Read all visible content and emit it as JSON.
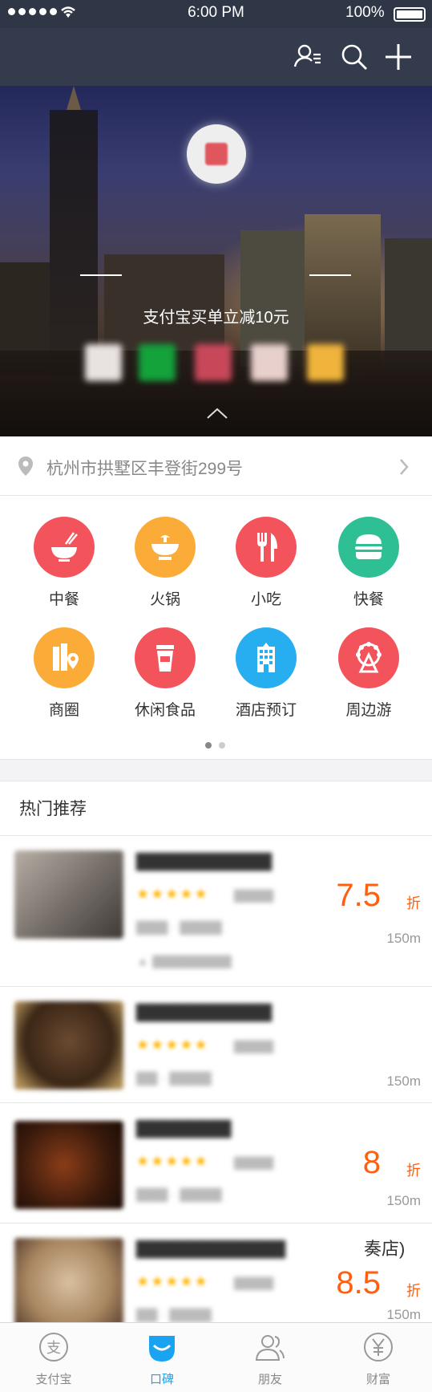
{
  "status_bar": {
    "time": "6:00 PM",
    "battery": "100%"
  },
  "nav": {
    "icons": [
      "contacts-icon",
      "search-icon",
      "add-icon"
    ]
  },
  "banner": {
    "subtitle": "支付宝买单立减10元",
    "colors": {
      "thumb1": "#e8e2e0",
      "thumb2": "#14a23b",
      "thumb3": "#c8485a",
      "thumb4": "#e8d0cc",
      "thumb5": "#f0b43c"
    }
  },
  "address": {
    "text": "杭州市拱墅区丰登街299号"
  },
  "categories": [
    {
      "label": "中餐",
      "icon": "bowl-chopsticks-icon",
      "color": "#f3545c"
    },
    {
      "label": "火锅",
      "icon": "hotpot-icon",
      "color": "#fbab38"
    },
    {
      "label": "小吃",
      "icon": "fork-knife-icon",
      "color": "#f3545c"
    },
    {
      "label": "快餐",
      "icon": "burger-icon",
      "color": "#2fbf95"
    },
    {
      "label": "商圈",
      "icon": "building-pin-icon",
      "color": "#fbab38"
    },
    {
      "label": "休闲食品",
      "icon": "cup-icon",
      "color": "#f3545c"
    },
    {
      "label": "酒店预订",
      "icon": "hotel-icon",
      "color": "#27aef0"
    },
    {
      "label": "周边游",
      "icon": "ferris-wheel-icon",
      "color": "#f3545c"
    }
  ],
  "pager": {
    "pages": 2,
    "current": 1
  },
  "hot": {
    "title": "热门推荐",
    "items": [
      {
        "discount": "7.5",
        "unit": "折",
        "distance": "150m",
        "colors": {
          "img": "#8a8580"
        }
      },
      {
        "discount": "",
        "unit": "",
        "distance": "150m",
        "colors": {
          "img": "#7a5030"
        }
      },
      {
        "discount": "8",
        "unit": "折",
        "distance": "150m",
        "colors": {
          "img": "#4a2a18"
        }
      },
      {
        "discount": "8.5",
        "unit": "折",
        "distance": "150m",
        "partial_name": "奏店)",
        "colors": {
          "img": "#c8b090"
        }
      }
    ]
  },
  "accent_color": "#1aa3f0",
  "discount_color": "#ff6010",
  "tabs": [
    {
      "label": "支付宝",
      "icon": "alipay-icon"
    },
    {
      "label": "口碑",
      "icon": "koubei-icon",
      "active": true
    },
    {
      "label": "朋友",
      "icon": "friends-icon"
    },
    {
      "label": "财富",
      "icon": "wealth-icon"
    }
  ]
}
